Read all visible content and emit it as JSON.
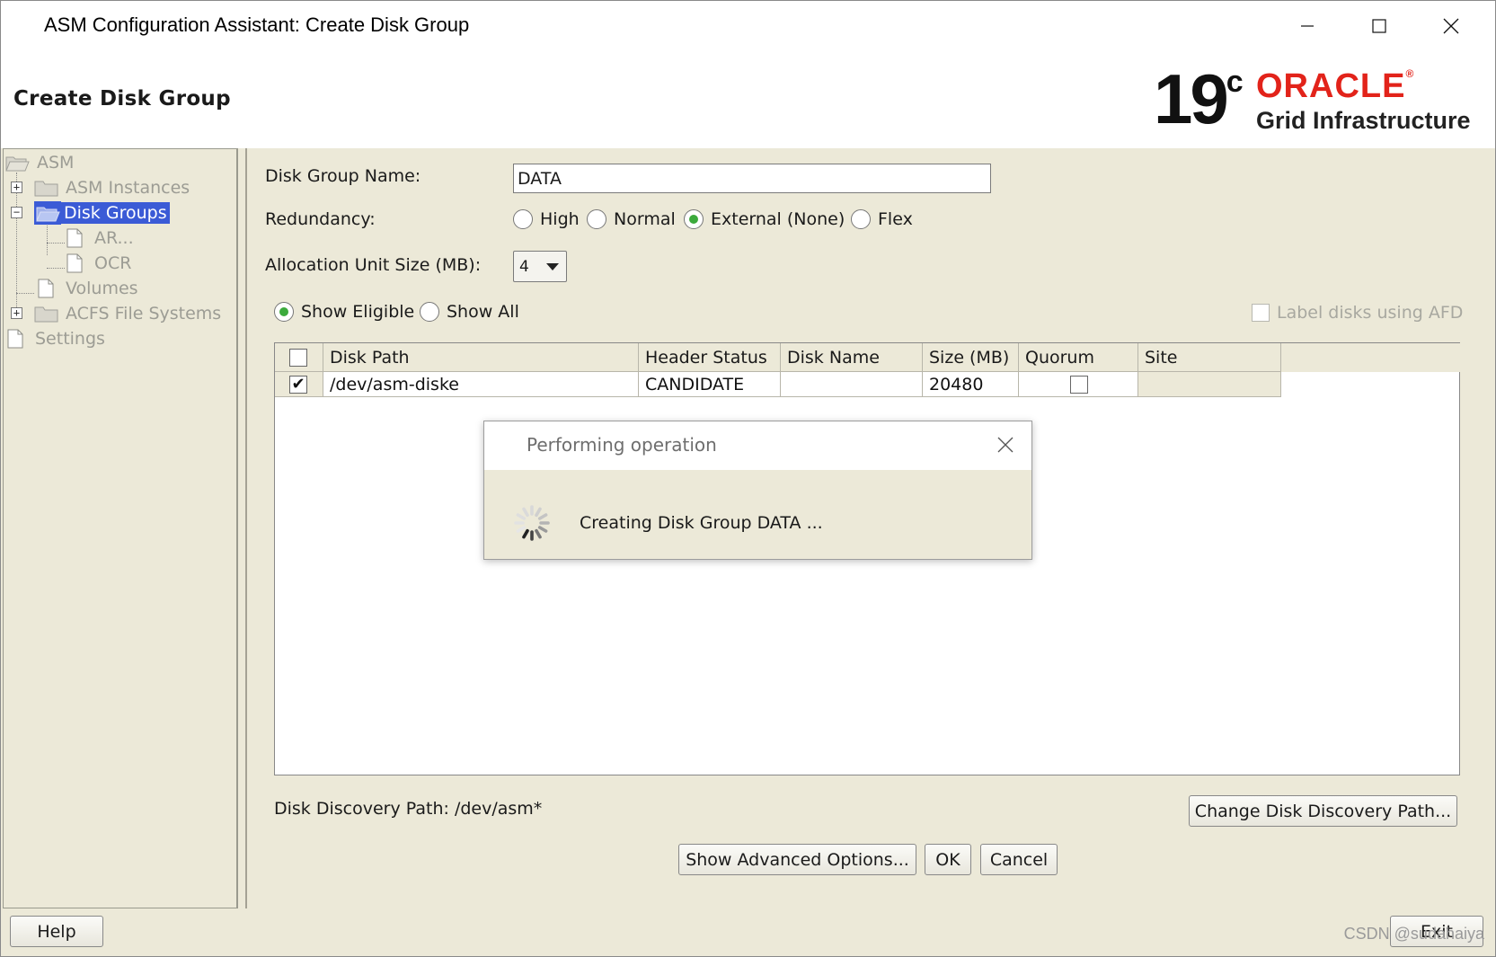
{
  "window": {
    "title": "ASM Configuration Assistant: Create Disk Group"
  },
  "header": {
    "page_title": "Create Disk Group",
    "logo_version": "19",
    "logo_version_sup": "c",
    "logo_brand": "ORACLE",
    "logo_product": "Grid Infrastructure"
  },
  "tree": {
    "asm": "ASM",
    "asm_instances": "ASM Instances",
    "disk_groups": "Disk Groups",
    "ar": "AR...",
    "ocr": "OCR",
    "volumes": "Volumes",
    "acfs": "ACFS File Systems",
    "settings": "Settings"
  },
  "form": {
    "disk_group_name_label": "Disk Group Name:",
    "disk_group_name_value": "DATA",
    "redundancy_label": "Redundancy:",
    "redundancy_options": [
      "High",
      "Normal",
      "External (None)",
      "Flex"
    ],
    "redundancy_selected": "External (None)",
    "au_label": "Allocation Unit Size (MB):",
    "au_value": "4",
    "show_eligible": "Show Eligible",
    "show_all": "Show All",
    "show_selected": "Show Eligible",
    "label_afd": "Label disks using AFD"
  },
  "table": {
    "columns": [
      "Disk Path",
      "Header Status",
      "Disk Name",
      "Size (MB)",
      "Quorum",
      "Site"
    ],
    "rows": [
      {
        "selected": true,
        "disk_path": "/dev/asm-diske",
        "header_status": "CANDIDATE",
        "disk_name": "",
        "size_mb": "20480",
        "quorum": false,
        "site": ""
      }
    ]
  },
  "discovery": {
    "path_label": "Disk Discovery Path: /dev/asm*",
    "change_button": "Change Disk Discovery Path..."
  },
  "buttons": {
    "advanced": "Show Advanced Options...",
    "ok": "OK",
    "cancel": "Cancel",
    "help": "Help",
    "exit": "Exit"
  },
  "dialog": {
    "title": "Performing operation",
    "message": "Creating Disk Group DATA ..."
  },
  "watermark": "CSDN @sudahaiya"
}
